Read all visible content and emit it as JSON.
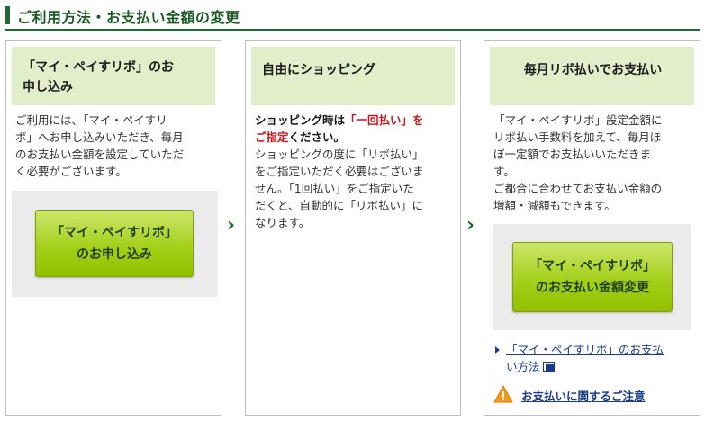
{
  "section": {
    "title": "ご利用方法・お支払い金額の変更"
  },
  "steps": [
    {
      "heading_line1": "「マイ・ペイすリボ」のお",
      "heading_line2": "申し込み",
      "body": [
        "ご利用には、「マイ・ペイすリ",
        "ボ」へお申し込みいただき、毎月",
        "のお支払い金額を設定していただ",
        "く必要がございます。"
      ],
      "button_line1": "「マイ・ペイすリボ」",
      "button_line2": "のお申し込み"
    },
    {
      "heading": "自由にショッピング",
      "lead_a": "ショッピング時は",
      "lead_red": "「一回払い」を",
      "lead_red2": "ご指定",
      "lead_b": "ください。",
      "body": [
        "ショッピングの度に「リボ払い」",
        "をご指定いただく必要はございま",
        "せん。「1回払い」をご指定いた",
        "だくと、自動的に「リボ払い」に",
        "なります。"
      ]
    },
    {
      "heading": "毎月リボ払いでお支払い",
      "body": [
        "「マイ・ペイすリボ」設定金額に",
        "リボ払い手数料を加えて、毎月ほ",
        "ぼ一定額でお支払いいただきま",
        "す。",
        "ご都合に合わせてお支払い金額の",
        "増額・減額もできます。"
      ],
      "button_line1": "「マイ・ペイすリボ」",
      "button_line2": "のお支払い金額変更",
      "link_line1": "「マイ・ペイすリボ」のお支払",
      "link_line2": "い方法",
      "notice": "お支払いに関するご注意"
    }
  ],
  "arrows": [
    "›",
    "›"
  ]
}
